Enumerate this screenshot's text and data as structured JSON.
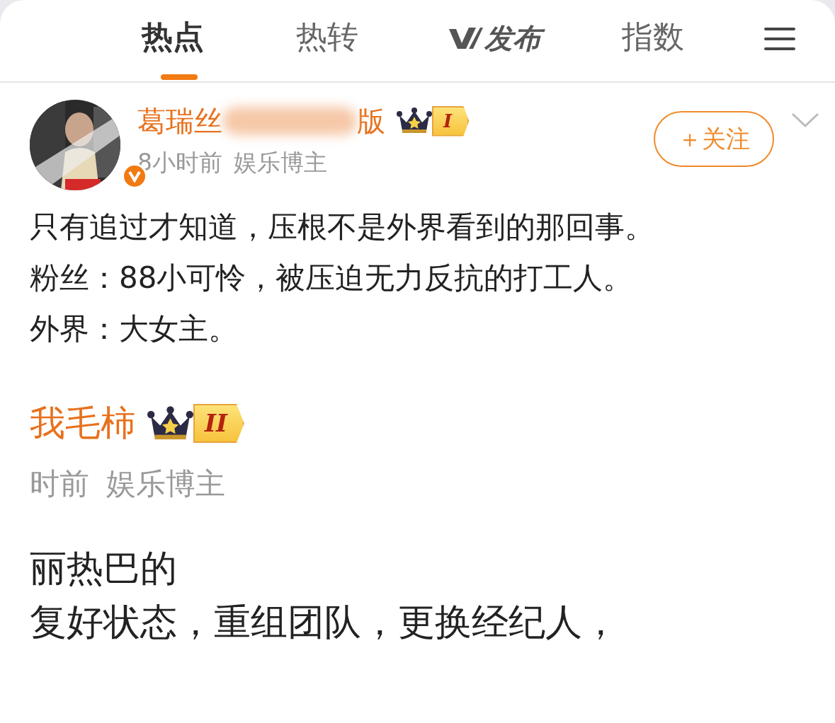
{
  "tabs": [
    {
      "label": "热点",
      "selected": true,
      "kind": "text"
    },
    {
      "label": "热转",
      "selected": false,
      "kind": "text"
    },
    {
      "label": "发布",
      "selected": false,
      "kind": "logo"
    },
    {
      "label": "指数",
      "selected": false,
      "kind": "text"
    }
  ],
  "post": {
    "author": {
      "name_start": "葛瑞丝",
      "name_end": "版",
      "level": "I",
      "verified": true
    },
    "time": "8小时前",
    "role": "娱乐博主",
    "follow_button": "＋关注",
    "lines": [
      "只有追过才知道，压根不是外界看到的那回事。",
      "粉丝：88小可怜，被压迫无力反抗的打工人。",
      "外界：大女主。"
    ]
  },
  "quoted_screenshot": {
    "author": {
      "name": "我毛柿",
      "level": "II"
    },
    "time": "时前",
    "role": "娱乐博主",
    "lines": [
      "丽热巴的",
      "复好状态，重组团队，更换经纪人，"
    ]
  }
}
